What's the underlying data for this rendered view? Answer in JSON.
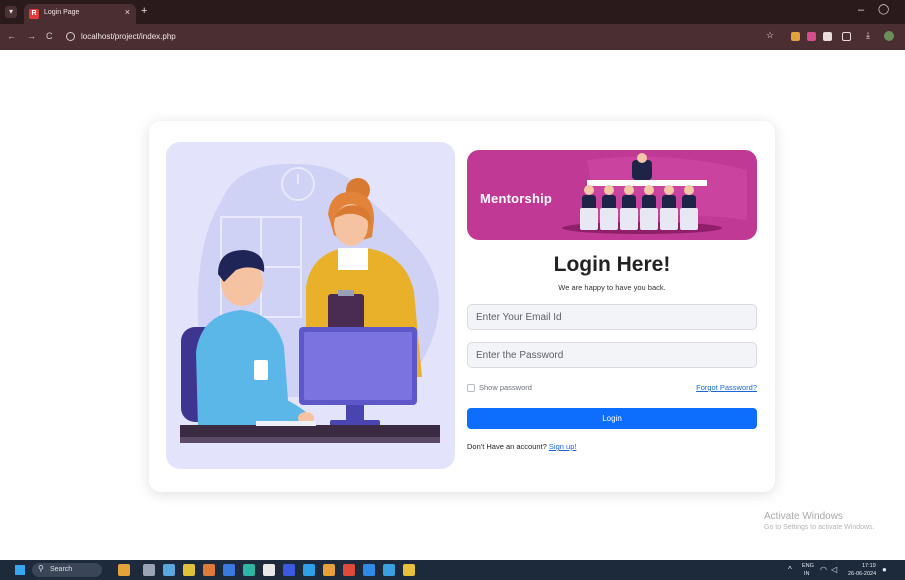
{
  "browser": {
    "tab_title": "Login Page",
    "tab_close": "×",
    "tab_new": "+",
    "window_minimize": "–",
    "window_maximize": "◯",
    "url": "localhost/project/index.php",
    "nav_back": "←",
    "nav_forward": "→",
    "nav_reload": "C",
    "star": "☆",
    "download": "⤓"
  },
  "login": {
    "banner_label": "Mentorship",
    "heading": "Login Here!",
    "subheading": "We are happy to have you back.",
    "email_placeholder": "Enter Your Email Id",
    "password_placeholder": "Enter the Password",
    "show_password_label": "Show password",
    "forgot_password": "Forgot Password?",
    "login_button": "Login",
    "no_account_text": "Don't Have an account?",
    "signup_link": "Sign up!"
  },
  "watermark": {
    "line1": "Activate Windows",
    "line2": "Go to Settings to activate Windows."
  },
  "taskbar": {
    "search_label": "Search",
    "language": "ENG",
    "region": "IN",
    "time": "17:19",
    "date": "26-06-2024"
  },
  "colors": {
    "banner": "#c03a95",
    "primary_button": "#0d6efd",
    "link": "#1a66d6",
    "illustration_bg": "#e3e4fb"
  },
  "icons": [
    "tab-menu-icon",
    "favicon-icon",
    "close-icon",
    "plus-icon",
    "minimize-icon",
    "maximize-icon",
    "back-icon",
    "forward-icon",
    "reload-icon",
    "site-info-icon",
    "star-icon",
    "extension-icon",
    "download-icon",
    "profile-icon",
    "windows-start-icon",
    "search-icon",
    "wifi-icon",
    "volume-icon"
  ]
}
